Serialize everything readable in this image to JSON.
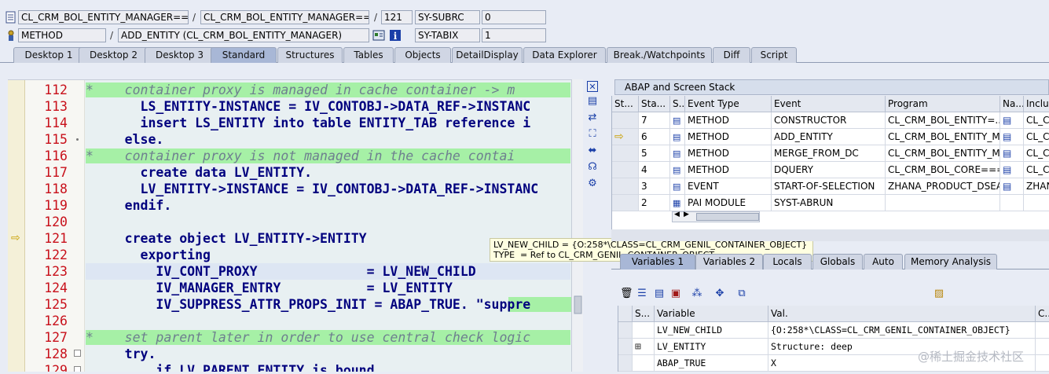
{
  "top": {
    "row1": {
      "class_name": "CL_CRM_BOL_ENTITY_MANAGER=====",
      "include_name": "CL_CRM_BOL_ENTITY_MANAGER====",
      "line": "121",
      "sysvar_name": "SY-SUBRC",
      "sysvar_value": "0"
    },
    "row2": {
      "event_type": "METHOD",
      "event_name": "ADD_ENTITY (CL_CRM_BOL_ENTITY_MANAGER)",
      "sysvar_name": "SY-TABIX",
      "sysvar_value": "1"
    },
    "slash": "/"
  },
  "tabs": [
    {
      "label": "Desktop 1"
    },
    {
      "label": "Desktop 2"
    },
    {
      "label": "Desktop 3"
    },
    {
      "label": "Standard"
    },
    {
      "label": "Structures"
    },
    {
      "label": "Tables"
    },
    {
      "label": "Objects"
    },
    {
      "label": "DetailDisplay"
    },
    {
      "label": "Data Explorer"
    },
    {
      "label": "Break./Watchpoints"
    },
    {
      "label": "Diff"
    },
    {
      "label": "Script"
    }
  ],
  "code": [
    {
      "n": "112",
      "text": "*    container proxy is managed in cache container -> m",
      "comment": true
    },
    {
      "n": "113",
      "text": "       LS_ENTITY-INSTANCE = IV_CONTOBJ->DATA_REF->INSTANC"
    },
    {
      "n": "114",
      "text": "       insert LS_ENTITY into table ENTITY_TAB reference i"
    },
    {
      "n": "115",
      "text": "     else."
    },
    {
      "n": "116",
      "text": "*    container proxy is not managed in the cache contai",
      "comment": true
    },
    {
      "n": "117",
      "text": "       create data LV_ENTITY."
    },
    {
      "n": "118",
      "text": "       LV_ENTITY->INSTANCE = IV_CONTOBJ->DATA_REF->INSTANC"
    },
    {
      "n": "119",
      "text": "     endif."
    },
    {
      "n": "120",
      "text": ""
    },
    {
      "n": "121",
      "text": "     create object LV_ENTITY->ENTITY"
    },
    {
      "n": "122",
      "text": "       exporting"
    },
    {
      "n": "123",
      "text": "         IV_CONT_PROXY              = LV_NEW_CHILD"
    },
    {
      "n": "124",
      "text": "         IV_MANAGER_ENTRY           = LV_ENTITY"
    },
    {
      "n": "125",
      "text": "         IV_SUPPRESS_ATTR_PROPS_INIT = ABAP_TRUE. \"suppre"
    },
    {
      "n": "126",
      "text": ""
    },
    {
      "n": "127",
      "text": "*    set parent later in order to use central check logic",
      "comment": true
    },
    {
      "n": "128",
      "text": "     try."
    },
    {
      "n": "129",
      "text": "         if LV_PARENT_ENTITY is bound"
    }
  ],
  "tooltip": {
    "line1": "LV_NEW_CHILD = {O:258*\\CLASS=CL_CRM_GENIL_CONTAINER_OBJECT}",
    "line2": "TYPE  = Ref to CL_CRM_GENIL_CONTAINER_OBJECT"
  },
  "stack": {
    "title": "ABAP and Screen Stack",
    "headers": [
      "St...",
      "Sta...",
      "S...",
      "Event Type",
      "Event",
      "Program",
      "Na...",
      "Inclu"
    ],
    "rows": [
      {
        "level": "7",
        "type": "METHOD",
        "event": "CONSTRUCTOR",
        "program": "CL_CRM_BOL_ENTITY=...",
        "include": "CL_CF"
      },
      {
        "level": "6",
        "type": "METHOD",
        "event": "ADD_ENTITY",
        "program": "CL_CRM_BOL_ENTITY_M...",
        "include": "CL_CF"
      },
      {
        "level": "5",
        "type": "METHOD",
        "event": "MERGE_FROM_DC",
        "program": "CL_CRM_BOL_ENTITY_M...",
        "include": "CL_CF"
      },
      {
        "level": "4",
        "type": "METHOD",
        "event": "DQUERY",
        "program": "CL_CRM_BOL_CORE===...",
        "include": "CL_CF"
      },
      {
        "level": "3",
        "type": "EVENT",
        "event": "START-OF-SELECTION",
        "program": "ZHANA_PRODUCT_DSEA...",
        "include": "ZHAN"
      },
      {
        "level": "2",
        "type": "PAI MODULE",
        "event": "SYST-ABRUN",
        "program": "",
        "include": ""
      }
    ]
  },
  "lower_tabs": [
    {
      "label": "Variables 1"
    },
    {
      "label": "Variables 2"
    },
    {
      "label": "Locals"
    },
    {
      "label": "Globals"
    },
    {
      "label": "Auto"
    },
    {
      "label": "Memory Analysis"
    }
  ],
  "vars": {
    "headers": [
      "S...",
      "Variable",
      "Val.",
      "C..."
    ],
    "rows": [
      {
        "name": "LV_NEW_CHILD",
        "value": "{O:258*\\CLASS=CL_CRM_GENIL_CONTAINER_OBJECT}"
      },
      {
        "name": "LV_ENTITY",
        "value": "Structure: deep"
      },
      {
        "name": "ABAP_TRUE",
        "value": "X"
      }
    ]
  },
  "watermark": "@稀土掘金技术社区"
}
